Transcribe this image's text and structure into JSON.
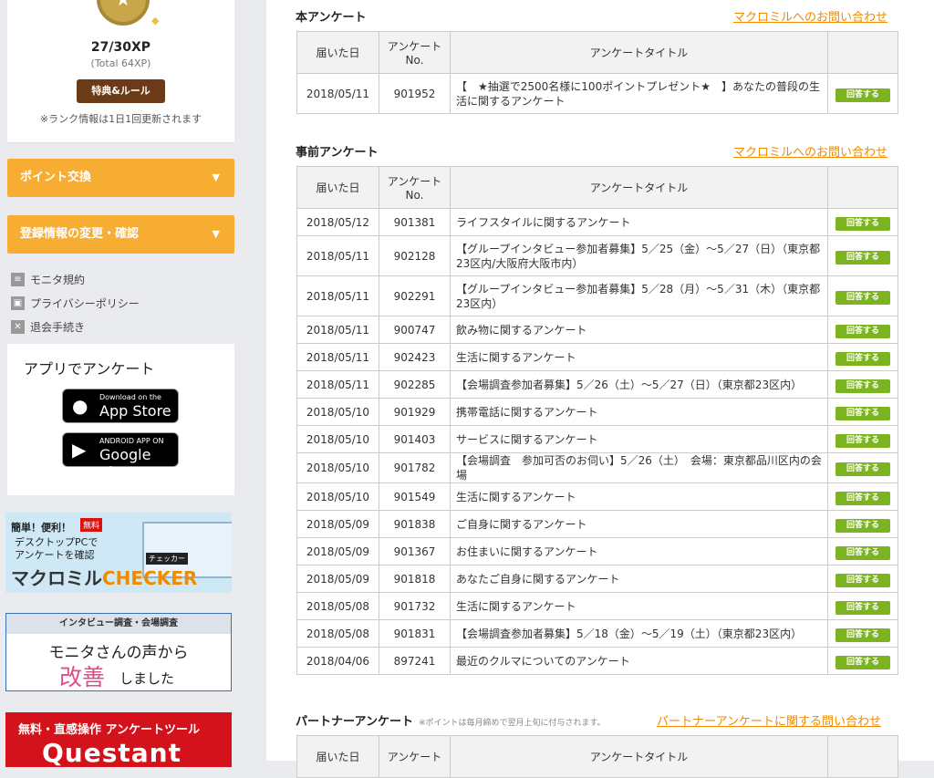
{
  "sidebar": {
    "rank": {
      "xp": "27/30XP",
      "total": "(Total 64XP)",
      "perk_button": "特典&ルール",
      "note": "※ランク情報は1日1回更新されます"
    },
    "point_exchange": "ポイント交換",
    "profile_edit": "登録情報の変更・確認",
    "links": [
      "モニタ規約",
      "プライバシーポリシー",
      "退会手続き"
    ],
    "app": {
      "title": "アプリでアンケート",
      "appstore_small": "Download on the",
      "appstore_big": "App Store",
      "google_small": "ANDROID APP ON",
      "google_big": "Google play"
    },
    "checker_banner": {
      "line1": "簡単！便利！",
      "free": "無料",
      "line2": "デスクトップPCで",
      "line3": "アンケートを確認",
      "tag": "チェッカー",
      "brand_a": "マクロミル",
      "brand_b": "CHECKER"
    },
    "interview_banner": {
      "header": "インタビュー調査・会場調査",
      "line1": "モニタさんの声から",
      "line2": "改善",
      "line3": "しました"
    },
    "questant_banner": {
      "line1": "無料・直感操作 アンケートツール",
      "line2": "Questant"
    }
  },
  "main": {
    "sections": [
      {
        "title": "本アンケート",
        "contact": "マクロミルへのお問い合わせ",
        "headers": {
          "date": "届いた日",
          "no": "アンケート No.",
          "title": "アンケートタイトル"
        },
        "rows": [
          {
            "date": "2018/05/11",
            "no": "901952",
            "title": "【　★抽選で2500名様に100ポイントプレゼント★　】あなたの普段の生活に関するアンケート",
            "button": "回答する"
          }
        ]
      },
      {
        "title": "事前アンケート",
        "contact": "マクロミルへのお問い合わせ",
        "headers": {
          "date": "届いた日",
          "no": "アンケート No.",
          "title": "アンケートタイトル"
        },
        "rows": [
          {
            "date": "2018/05/12",
            "no": "901381",
            "title": "ライフスタイルに関するアンケート",
            "button": "回答する"
          },
          {
            "date": "2018/05/11",
            "no": "902128",
            "title": "【グループインタビュー参加者募集】5／25（金）～5／27（日）（東京都23区内/大阪府大阪市内）",
            "button": "回答する"
          },
          {
            "date": "2018/05/11",
            "no": "902291",
            "title": "【グループインタビュー参加者募集】5／28（月）～5／31（木）（東京都23区内）",
            "button": "回答する"
          },
          {
            "date": "2018/05/11",
            "no": "900747",
            "title": "飲み物に関するアンケート",
            "button": "回答する"
          },
          {
            "date": "2018/05/11",
            "no": "902423",
            "title": "生活に関するアンケート",
            "button": "回答する"
          },
          {
            "date": "2018/05/11",
            "no": "902285",
            "title": "【会場調査参加者募集】5／26（土）～5／27（日）（東京都23区内）",
            "button": "回答する"
          },
          {
            "date": "2018/05/10",
            "no": "901929",
            "title": "携帯電話に関するアンケート",
            "button": "回答する"
          },
          {
            "date": "2018/05/10",
            "no": "901403",
            "title": "サービスに関するアンケート",
            "button": "回答する"
          },
          {
            "date": "2018/05/10",
            "no": "901782",
            "title": "【会場調査　参加可否のお伺い】5／26（土）　会場：東京都品川区内の会場",
            "button": "回答する"
          },
          {
            "date": "2018/05/10",
            "no": "901549",
            "title": "生活に関するアンケート",
            "button": "回答する"
          },
          {
            "date": "2018/05/09",
            "no": "901838",
            "title": "ご自身に関するアンケート",
            "button": "回答する"
          },
          {
            "date": "2018/05/09",
            "no": "901367",
            "title": "お住まいに関するアンケート",
            "button": "回答する"
          },
          {
            "date": "2018/05/09",
            "no": "901818",
            "title": "あなたご自身に関するアンケート",
            "button": "回答する"
          },
          {
            "date": "2018/05/08",
            "no": "901732",
            "title": "生活に関するアンケート",
            "button": "回答する"
          },
          {
            "date": "2018/05/08",
            "no": "901831",
            "title": "【会場調査参加者募集】5／18（金）～5／19（土）（東京都23区内）",
            "button": "回答する"
          },
          {
            "date": "2018/04/06",
            "no": "897241",
            "title": "最近のクルマについてのアンケート",
            "button": "回答する"
          }
        ]
      },
      {
        "title": "パートナーアンケート",
        "note": "※ポイントは毎月締めで翌月上旬に付与されます。",
        "contact": "パートナーアンケートに関する問い合わせ",
        "headers": {
          "date": "届いた日",
          "no": "アンケート",
          "title": "アンケートタイトル"
        },
        "rows": []
      }
    ]
  },
  "colors": {
    "orange": "#f7ad32",
    "answer_green": "#7cb321",
    "link_orange": "#f08a00",
    "perk_brown": "#6b3a17"
  }
}
